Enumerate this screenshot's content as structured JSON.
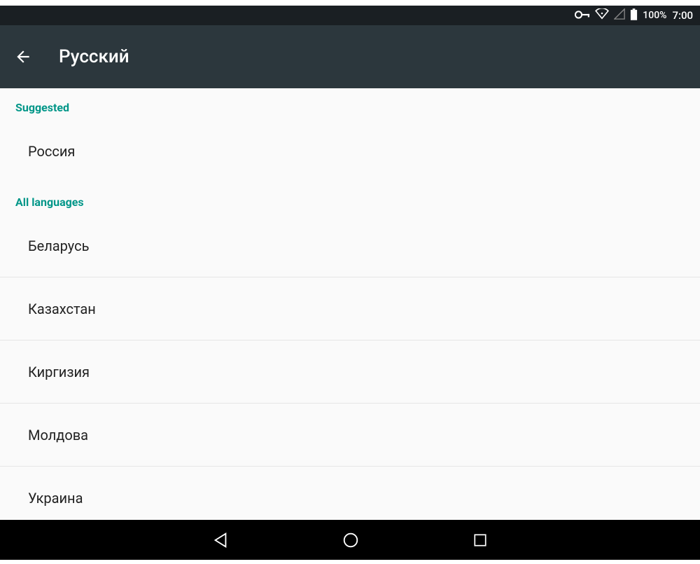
{
  "status": {
    "battery_pct": "100%",
    "time": "7:00"
  },
  "header": {
    "title": "Русский"
  },
  "sections": {
    "suggested_label": "Suggested",
    "all_label": "All languages"
  },
  "suggested": [
    {
      "label": "Россия"
    }
  ],
  "all": [
    {
      "label": "Беларусь"
    },
    {
      "label": "Казахстан"
    },
    {
      "label": "Киргизия"
    },
    {
      "label": "Молдова"
    },
    {
      "label": "Украина"
    }
  ]
}
